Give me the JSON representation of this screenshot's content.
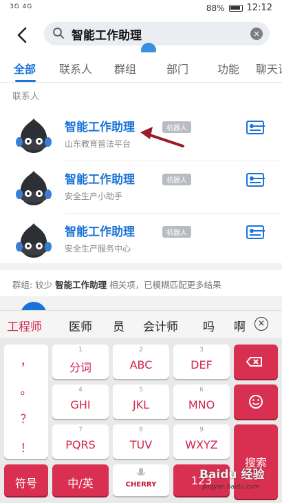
{
  "status_bar": {
    "signal": "3G 4G",
    "battery": "88%",
    "time": "12:12"
  },
  "search": {
    "query": "智能工作助理",
    "back_label": "‹",
    "clear_label": "×"
  },
  "tabs": [
    {
      "label": "全部"
    },
    {
      "label": "联系人"
    },
    {
      "label": "群组"
    },
    {
      "label": "部门"
    },
    {
      "label": "功能"
    },
    {
      "label": "聊天记"
    }
  ],
  "contacts": {
    "title": "联系人",
    "badge": "机器人",
    "items": [
      {
        "name": "智能工作助理",
        "desc": "山东教育普法平台"
      },
      {
        "name": "智能工作助理",
        "desc": "安全生产小助手"
      },
      {
        "name": "智能工作助理",
        "desc": "安全生产服务中心"
      }
    ]
  },
  "group_notice": {
    "prefix": "群组: 较少",
    "keyword": "智能工作助理",
    "suffix": "相关项，已模糊匹配更多结果"
  },
  "candidates": [
    "工程师",
    "医师",
    "员",
    "会计师",
    "吗",
    "啊"
  ],
  "keyboard": {
    "punct": [
      "，",
      "。",
      "？",
      "！"
    ],
    "keys": [
      {
        "num": "1",
        "label": "分词"
      },
      {
        "num": "2",
        "label": "ABC"
      },
      {
        "num": "3",
        "label": "DEF"
      },
      {
        "num": "4",
        "label": "GHI"
      },
      {
        "num": "5",
        "label": "JKL"
      },
      {
        "num": "6",
        "label": "MNO"
      },
      {
        "num": "7",
        "label": "PQRS"
      },
      {
        "num": "8",
        "label": "TUV"
      },
      {
        "num": "9",
        "label": "WXYZ"
      }
    ],
    "symbol": "符号",
    "lang": "中/英",
    "space": "CHERRY",
    "num123": "123",
    "search": "搜索"
  },
  "watermark": {
    "logo": "Baidu 经验",
    "url": "jingyan.baidu.com"
  },
  "colors": {
    "accent": "#1a73d9",
    "keyboard_red": "#d92f50"
  }
}
